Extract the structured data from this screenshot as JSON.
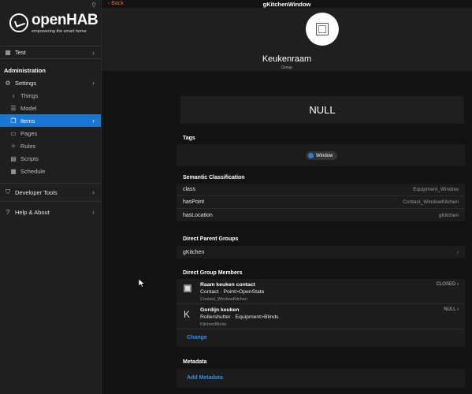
{
  "sidebar": {
    "logo_name": "openHAB",
    "logo_tagline": "empowering the smart home",
    "test_label": "Test",
    "admin_header": "Administration",
    "settings_label": "Settings",
    "things_label": "Things",
    "model_label": "Model",
    "items_label": "Items",
    "pages_label": "Pages",
    "rules_label": "Rules",
    "scripts_label": "Scripts",
    "schedule_label": "Schedule",
    "devtools_label": "Developer Tools",
    "help_label": "Help & About"
  },
  "topbar": {
    "back_label": "Back",
    "title": "gKitchenWindow"
  },
  "item": {
    "label": "Keukenraam",
    "type": "Group",
    "state": "NULL"
  },
  "tags": {
    "title": "Tags",
    "items": [
      "Window"
    ]
  },
  "semantic": {
    "title": "Semantic Classification",
    "rows": [
      {
        "key": "class",
        "value": "Equipment_Window"
      },
      {
        "key": "hasPoint",
        "value": "Contact_WindowKitchen"
      },
      {
        "key": "hasLocation",
        "value": "gKitchen"
      }
    ]
  },
  "parents": {
    "title": "Direct Parent Groups",
    "items": [
      "gKitchen"
    ]
  },
  "members": {
    "title": "Direct Group Members",
    "items": [
      {
        "name": "Raam keuken contact",
        "semantics": "Contact · Point>OpenState",
        "id": "Contact_WindowKitchen",
        "state": "CLOSED"
      },
      {
        "name": "Gordijn keuken",
        "semantics": "Rollershutter · Equipment>Blinds",
        "id": "KitchenBlinds",
        "state": "NULL"
      }
    ],
    "change_label": "Change"
  },
  "metadata": {
    "title": "Metadata",
    "add_label": "Add Metadata"
  },
  "colors": {
    "accent": "#1976d2",
    "link": "#2e90e8",
    "back": "#e3622f",
    "background": "#121212"
  }
}
